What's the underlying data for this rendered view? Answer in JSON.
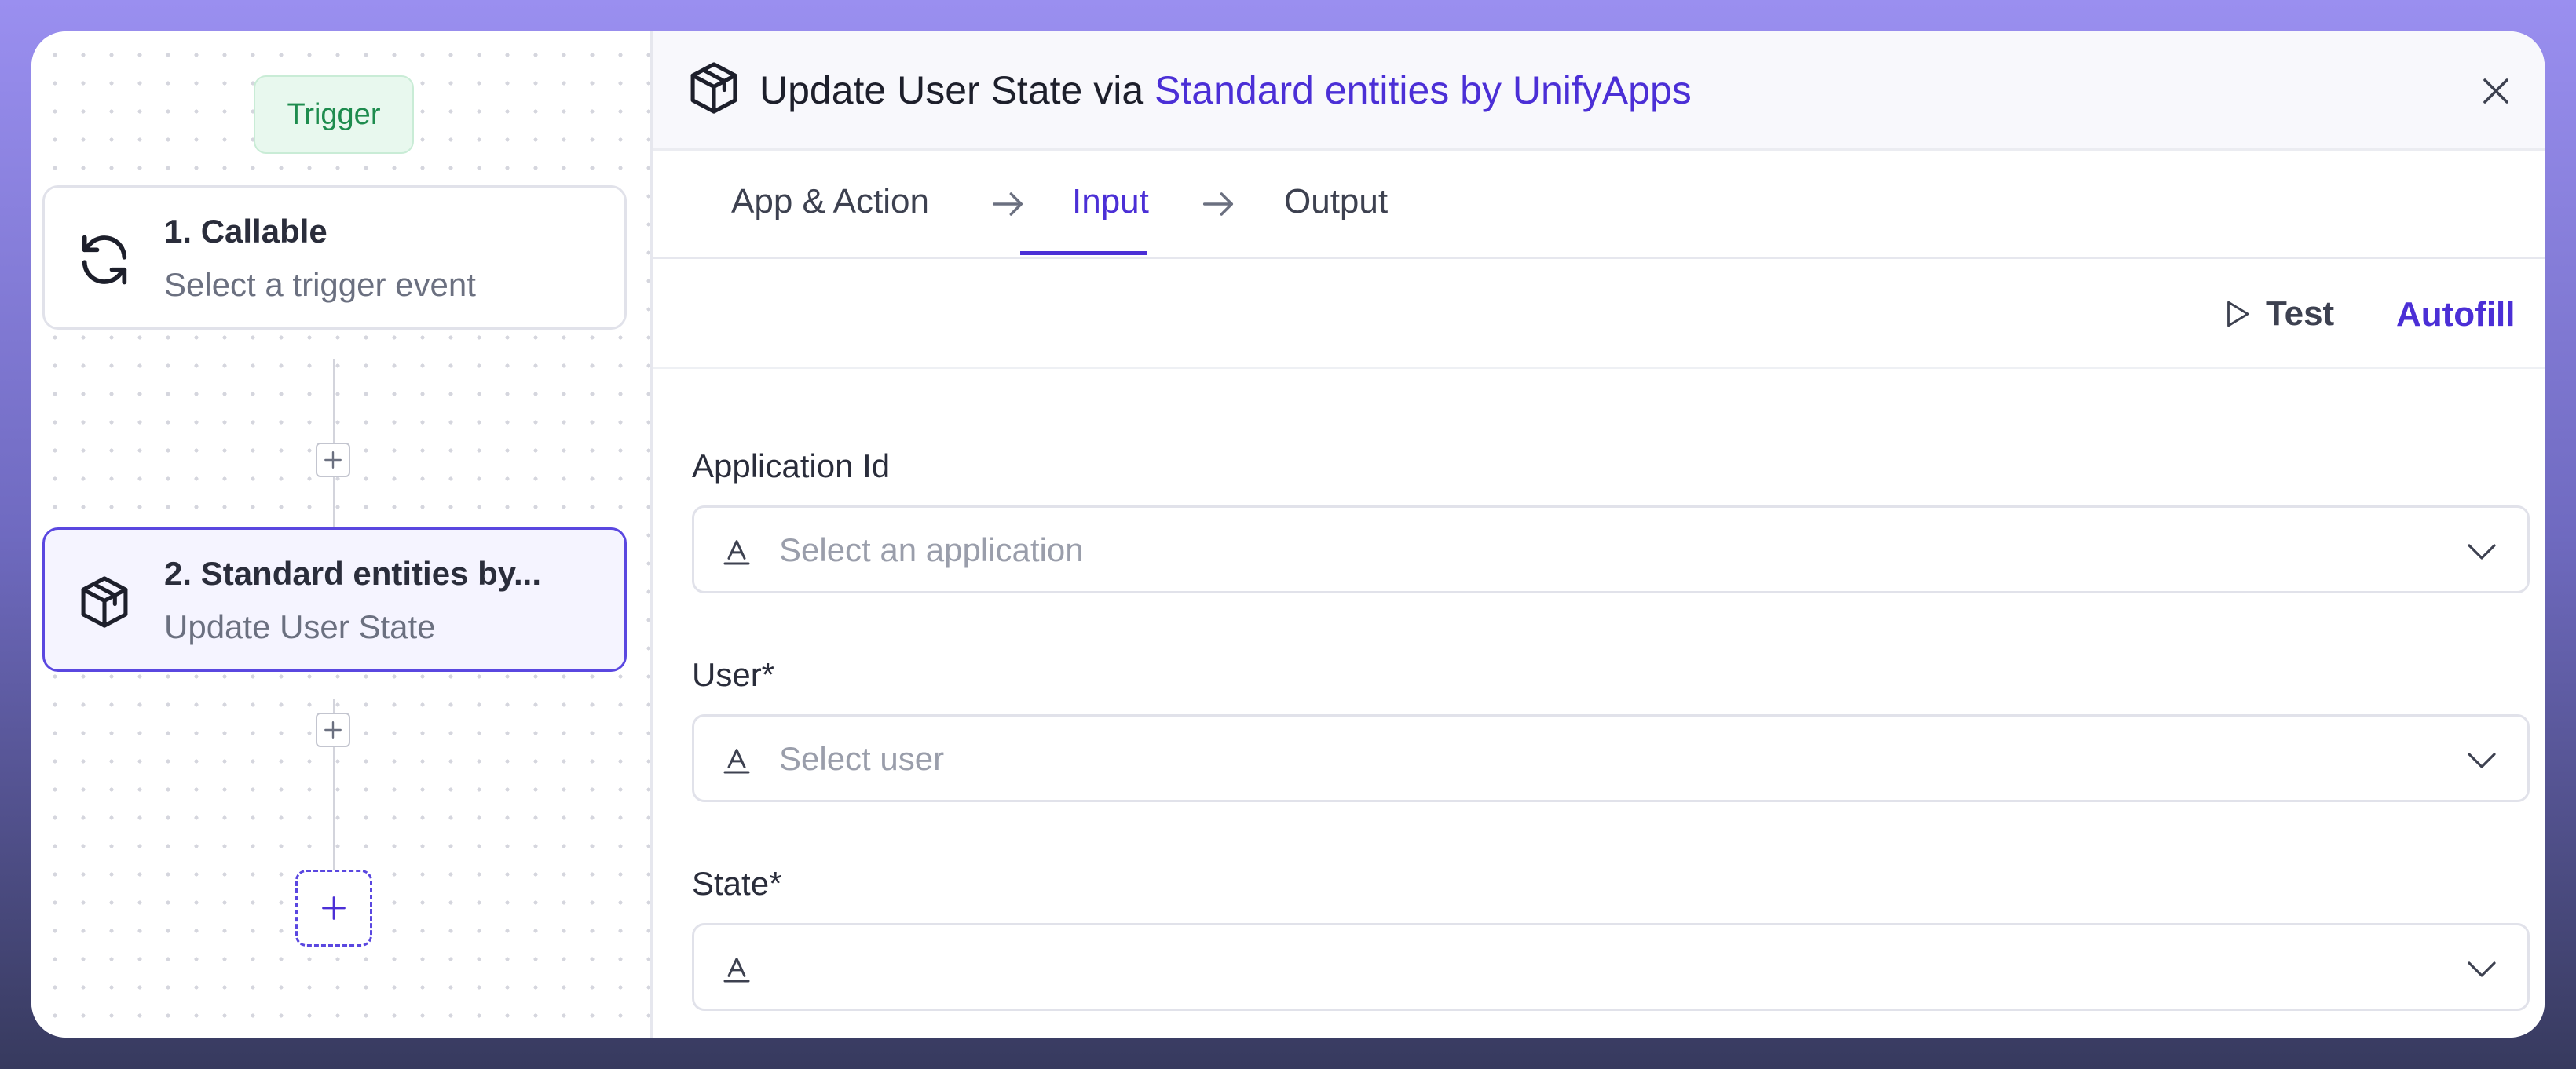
{
  "colors": {
    "accent": "#4b2fd6",
    "trigger_green": "#1e8c4e",
    "background_top": "#9a8ff0"
  },
  "canvas": {
    "trigger_label": "Trigger",
    "nodes": [
      {
        "title": "1. Callable",
        "subtitle": "Select a trigger event",
        "icon": "refresh-icon"
      },
      {
        "title": "2. Standard entities by...",
        "subtitle": "Update User State",
        "icon": "package-icon"
      }
    ]
  },
  "panel": {
    "title_prefix": "Update User State via",
    "title_app": "Standard entities by UnifyApps",
    "tabs": [
      {
        "label": "App & Action"
      },
      {
        "label": "Input"
      },
      {
        "label": "Output"
      }
    ],
    "active_tab": "Input",
    "actions": {
      "test_label": "Test",
      "autofill_label": "Autofill"
    },
    "fields": [
      {
        "label": "Application Id",
        "placeholder": "Select an application"
      },
      {
        "label": "User*",
        "placeholder": "Select user"
      },
      {
        "label": "State*",
        "placeholder": ""
      }
    ]
  }
}
